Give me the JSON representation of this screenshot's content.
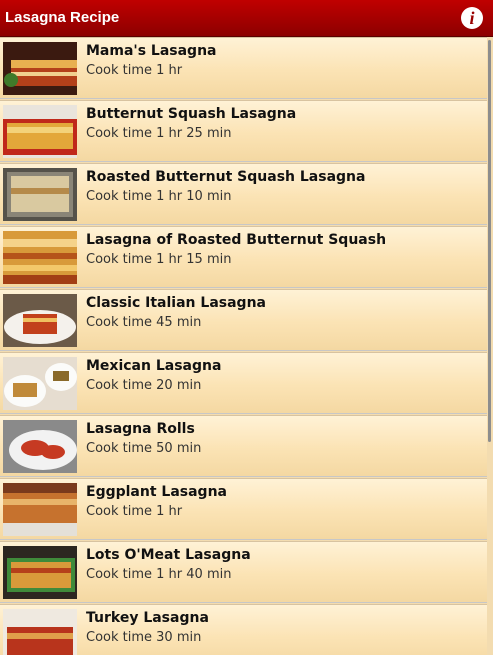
{
  "app": {
    "title": "Lasagna Recipe",
    "info_label": "i"
  },
  "recipes": [
    {
      "name": "Mama's Lasagna",
      "cook_time": "Cook time 1 hr"
    },
    {
      "name": "Butternut Squash Lasagna",
      "cook_time": "Cook time 1 hr 25 min"
    },
    {
      "name": "Roasted Butternut Squash Lasagna",
      "cook_time": "Cook time 1 hr 10 min"
    },
    {
      "name": "Lasagna of Roasted Butternut Squash",
      "cook_time": "Cook time 1 hr 15 min"
    },
    {
      "name": "Classic Italian Lasagna",
      "cook_time": "Cook time 45 min"
    },
    {
      "name": "Mexican Lasagna",
      "cook_time": "Cook time 20 min"
    },
    {
      "name": "Lasagna Rolls",
      "cook_time": "Cook time 50 min"
    },
    {
      "name": "Eggplant Lasagna",
      "cook_time": "Cook time 1 hr"
    },
    {
      "name": "Lots O'Meat Lasagna",
      "cook_time": "Cook time 1 hr 40 min"
    },
    {
      "name": "Turkey Lasagna",
      "cook_time": "Cook time 30 min"
    }
  ],
  "colors": {
    "titlebar": "#b00000",
    "row_background": "#fbe3b4"
  }
}
